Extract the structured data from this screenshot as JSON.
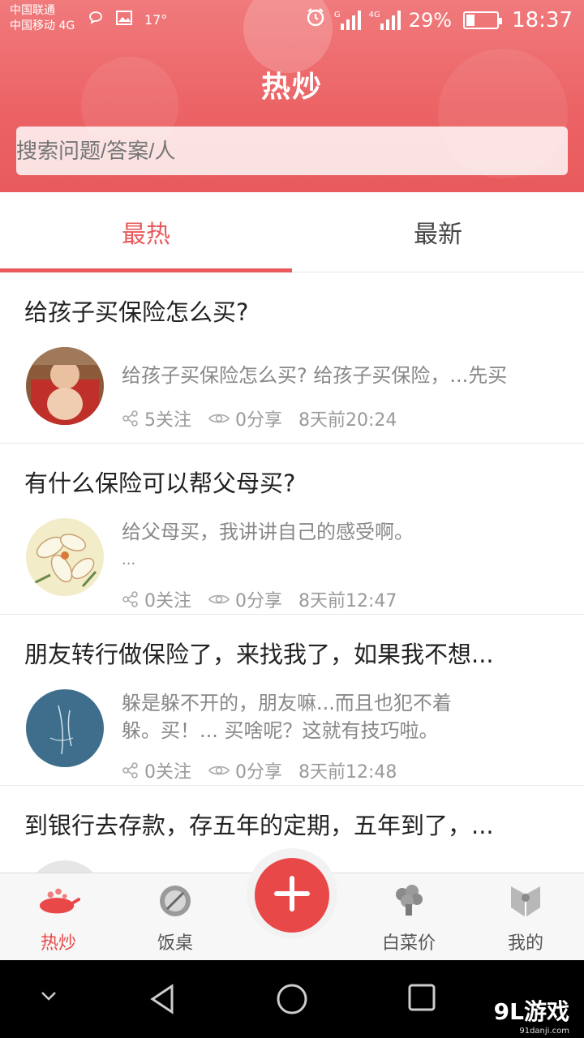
{
  "status_bar": {
    "carrier_1": "中国联通",
    "carrier_2": "中国移动 4G",
    "temperature": "17°",
    "network_1": "G",
    "network_2": "4G",
    "battery": "29%",
    "battery_level": 0.29,
    "time": "18:37"
  },
  "header": {
    "title": "热炒",
    "search_placeholder": "搜索问题/答案/人"
  },
  "tabs": [
    {
      "label": "最热",
      "active": true
    },
    {
      "label": "最新",
      "active": false
    }
  ],
  "feed": [
    {
      "title": "给孩子买保险怎么买?",
      "excerpt_line1": "给孩子买保险怎么买?  给孩子买保险，...先买",
      "excerpt_line2": "",
      "follows": "5关注",
      "shares": "0分享",
      "time": "8天前20:24"
    },
    {
      "title": "有什么保险可以帮父母买?",
      "excerpt_line1": "给父母买，我讲讲自己的感受啊。",
      "excerpt_line2": "...",
      "follows": "0关注",
      "shares": "0分享",
      "time": "8天前12:47"
    },
    {
      "title": "朋友转行做保险了，来找我了，如果我不想...",
      "excerpt_line1": "躲是躲不开的，朋友嘛...而且也犯不着",
      "excerpt_line2": "躲。买！... 买啥呢？这就有技巧啦。",
      "follows": "0关注",
      "shares": "0分享",
      "time": "8天前12:48"
    },
    {
      "title": "到银行去存款，存五年的定期，五年到了，...",
      "excerpt_line1": "",
      "excerpt_line2": "",
      "follows": "",
      "shares": "",
      "time": ""
    }
  ],
  "tabbar": [
    {
      "label": "热炒",
      "icon": "wok-icon",
      "active": true
    },
    {
      "label": "饭桌",
      "icon": "plate-icon",
      "active": false
    },
    {
      "label": "",
      "icon": "plus-icon",
      "active": false
    },
    {
      "label": "白菜价",
      "icon": "cabbage-icon",
      "active": false
    },
    {
      "label": "我的",
      "icon": "profile-icon",
      "active": false
    }
  ],
  "watermark": {
    "brand": "9L游戏",
    "site": "91danji.com"
  },
  "colors": {
    "accent": "#e85a5c",
    "fab": "#e84848"
  }
}
